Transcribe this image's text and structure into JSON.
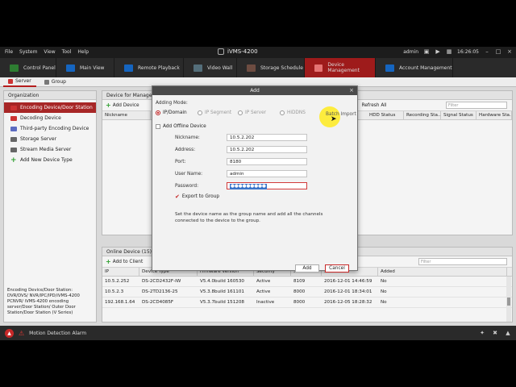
{
  "menu": [
    "File",
    "System",
    "View",
    "Tool",
    "Help"
  ],
  "app_title": "iVMS-4200",
  "titlebar_right": {
    "user": "admin",
    "time": "16:26:05"
  },
  "nav_tabs": [
    {
      "label": "Control Panel",
      "color": "#2e7d32"
    },
    {
      "label": "Main View",
      "color": "#1565c0"
    },
    {
      "label": "Remote Playback",
      "color": "#1565c0"
    },
    {
      "label": "Video Wall",
      "color": "#546e7a"
    },
    {
      "label": "Storage Schedule",
      "color": "#6d4c41"
    },
    {
      "label": "Device Management",
      "color": "#c62828"
    },
    {
      "label": "Account Management",
      "color": "#1565c0"
    }
  ],
  "subtabs": [
    "Server",
    "Group"
  ],
  "org": {
    "header": "Organization",
    "items": [
      "Encoding Device/Door Station",
      "Decoding Device",
      "Third-party Encoding Device",
      "Storage Server",
      "Stream Media Server",
      "Add New Device Type"
    ],
    "description": "Encoding Device/Door Station: DVR/DVS/ NVR/IPC/IPD/iVMS-4200 PCNVR/ iVMS-4200 encoding server/Door Station/ Outer Door Station/Door Station (V Series)"
  },
  "device_panel": {
    "header": "Device for Management",
    "add_label": "Add Device",
    "refresh_label": "Refresh All",
    "filter_placeholder": "Filter",
    "columns": [
      "Nickname",
      "HDD Status",
      "Recording Sta...",
      "Signal Status",
      "Hardware Sta..."
    ]
  },
  "online_panel": {
    "header": "Online Device (15)",
    "add_label": "Add to Client",
    "filter_placeholder": "Filter",
    "columns": [
      "IP",
      "Device Type",
      "Firmware Version",
      "Security",
      "Server Port",
      "Start Time",
      "Added"
    ],
    "rows": [
      [
        "10.5.2.252",
        "DS-2CD2432F-IW",
        "V5.4.0build 160530",
        "Active",
        "8109",
        "2016-12-01 14:46:59",
        "No"
      ],
      [
        "10.5.2.3",
        "DS-2TD2136-25",
        "V5.3.8build 161101",
        "Active",
        "8000",
        "2016-12-01 18:34:01",
        "No"
      ],
      [
        "192.168.1.64",
        "DS-2CD4085F",
        "V5.3.7build 151208",
        "Inactive",
        "8000",
        "2016-12-05 18:28:32",
        "No"
      ]
    ]
  },
  "status": {
    "label": "Motion Detection Alarm"
  },
  "dialog": {
    "title": "Add",
    "adding_mode_label": "Adding Mode:",
    "modes": [
      "IP/Domain",
      "IP Segment",
      "IP Server",
      "HiDDNS",
      "Batch Import"
    ],
    "offline_label": "Add Offline Device",
    "fields": {
      "nickname_label": "Nickname:",
      "nickname": "10.5.2.202",
      "address_label": "Address:",
      "address": "10.5.2.202",
      "port_label": "Port:",
      "port": "8180",
      "username_label": "User Name:",
      "username": "admin",
      "password_label": "Password:",
      "password": "●●●●●●●●●"
    },
    "export_label": "Export to Group",
    "note": "Set the device name as the group name and add all the channels connected to the device to the group.",
    "add_button": "Add",
    "cancel_button": "Cancel"
  }
}
